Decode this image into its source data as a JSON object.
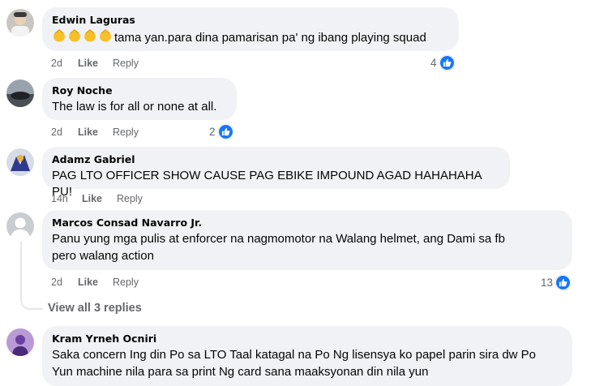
{
  "colors": {
    "like_blue": "#1877f2",
    "bubble_bg": "#f0f2f5",
    "meta_gray": "#65676b"
  },
  "actions": {
    "like": "Like",
    "reply": "Reply"
  },
  "comments": [
    {
      "author": "Edwin Laguras",
      "emoji_icons": [
        "clapping-hands-icon",
        "clapping-hands-icon",
        "clapping-hands-icon",
        "clapping-hands-icon"
      ],
      "text": "tama yan.para dina pamarisan pa' ng ibang playing squad",
      "time": "2d",
      "reactions": "4"
    },
    {
      "author": "Roy Noche",
      "text": "The law is for all or none at all.",
      "time": "2d",
      "reactions": "2"
    },
    {
      "author": "Adamz Gabriel",
      "text": "PAG LTO OFFICER SHOW CAUSE PAG EBIKE IMPOUND AGAD HAHAHAHA PU!",
      "time": "14h",
      "reactions": ""
    },
    {
      "author": "Marcos Consad Navarro Jr.",
      "text_line1": "Panu yung mga pulis at enforcer na nagmomotor na Walang helmet, ang Dami sa fb",
      "text_line2": "pero walang action",
      "time": "2d",
      "reactions": "13"
    },
    {
      "author": "Kram Yrneh Ocniri",
      "text_line1": "Saka concern Ing din Po sa LTO Taal katagal na Po Ng lisensya ko papel parin sira dw Po",
      "text_line2": "Yun machine nila para sa print Ng card sana maaksyonan din nila yun"
    }
  ],
  "view_replies": "View all 3 replies"
}
